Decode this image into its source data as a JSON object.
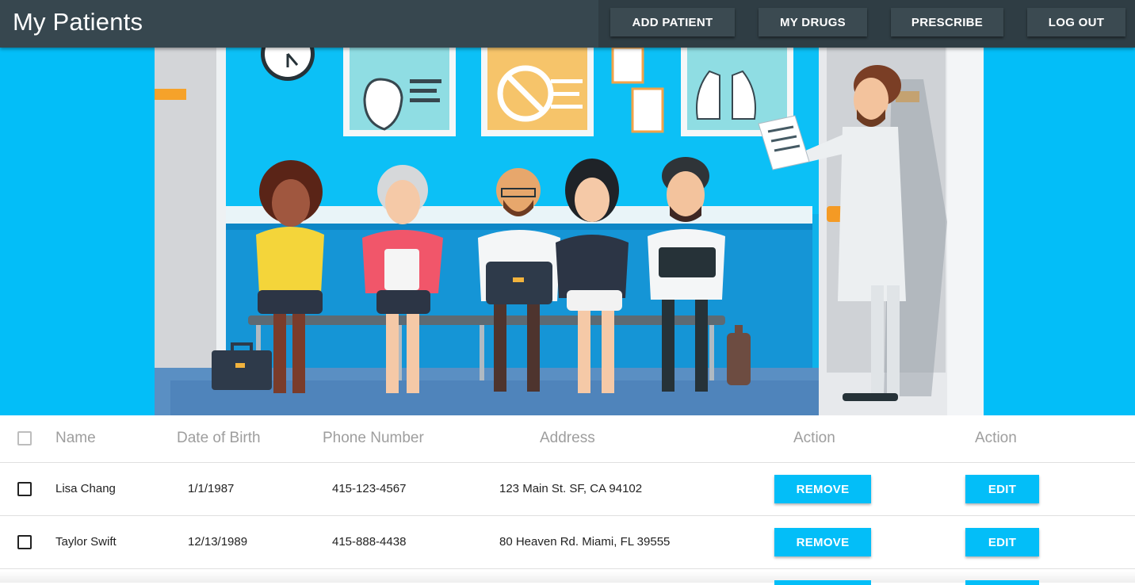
{
  "header": {
    "title": "My Patients",
    "nav": [
      "ADD PATIENT",
      "MY DRUGS",
      "PRESCRIBE",
      "LOG OUT"
    ]
  },
  "table": {
    "columns": [
      "Name",
      "Date of Birth",
      "Phone Number",
      "Address",
      "Action",
      "Action"
    ],
    "rows": [
      {
        "name": "Lisa Chang",
        "dob": "1/1/1987",
        "phone": "415-123-4567",
        "address": "123 Main St. SF, CA 94102",
        "remove": "REMOVE",
        "edit": "EDIT"
      },
      {
        "name": "Taylor Swift",
        "dob": "12/13/1989",
        "phone": "415-888-4438",
        "address": "80 Heaven Rd. Miami, FL 39555",
        "remove": "REMOVE",
        "edit": "EDIT"
      }
    ]
  },
  "colors": {
    "appbar": "#37474f",
    "accent": "#03bef8"
  },
  "hero_image": "waiting-room-illustration"
}
